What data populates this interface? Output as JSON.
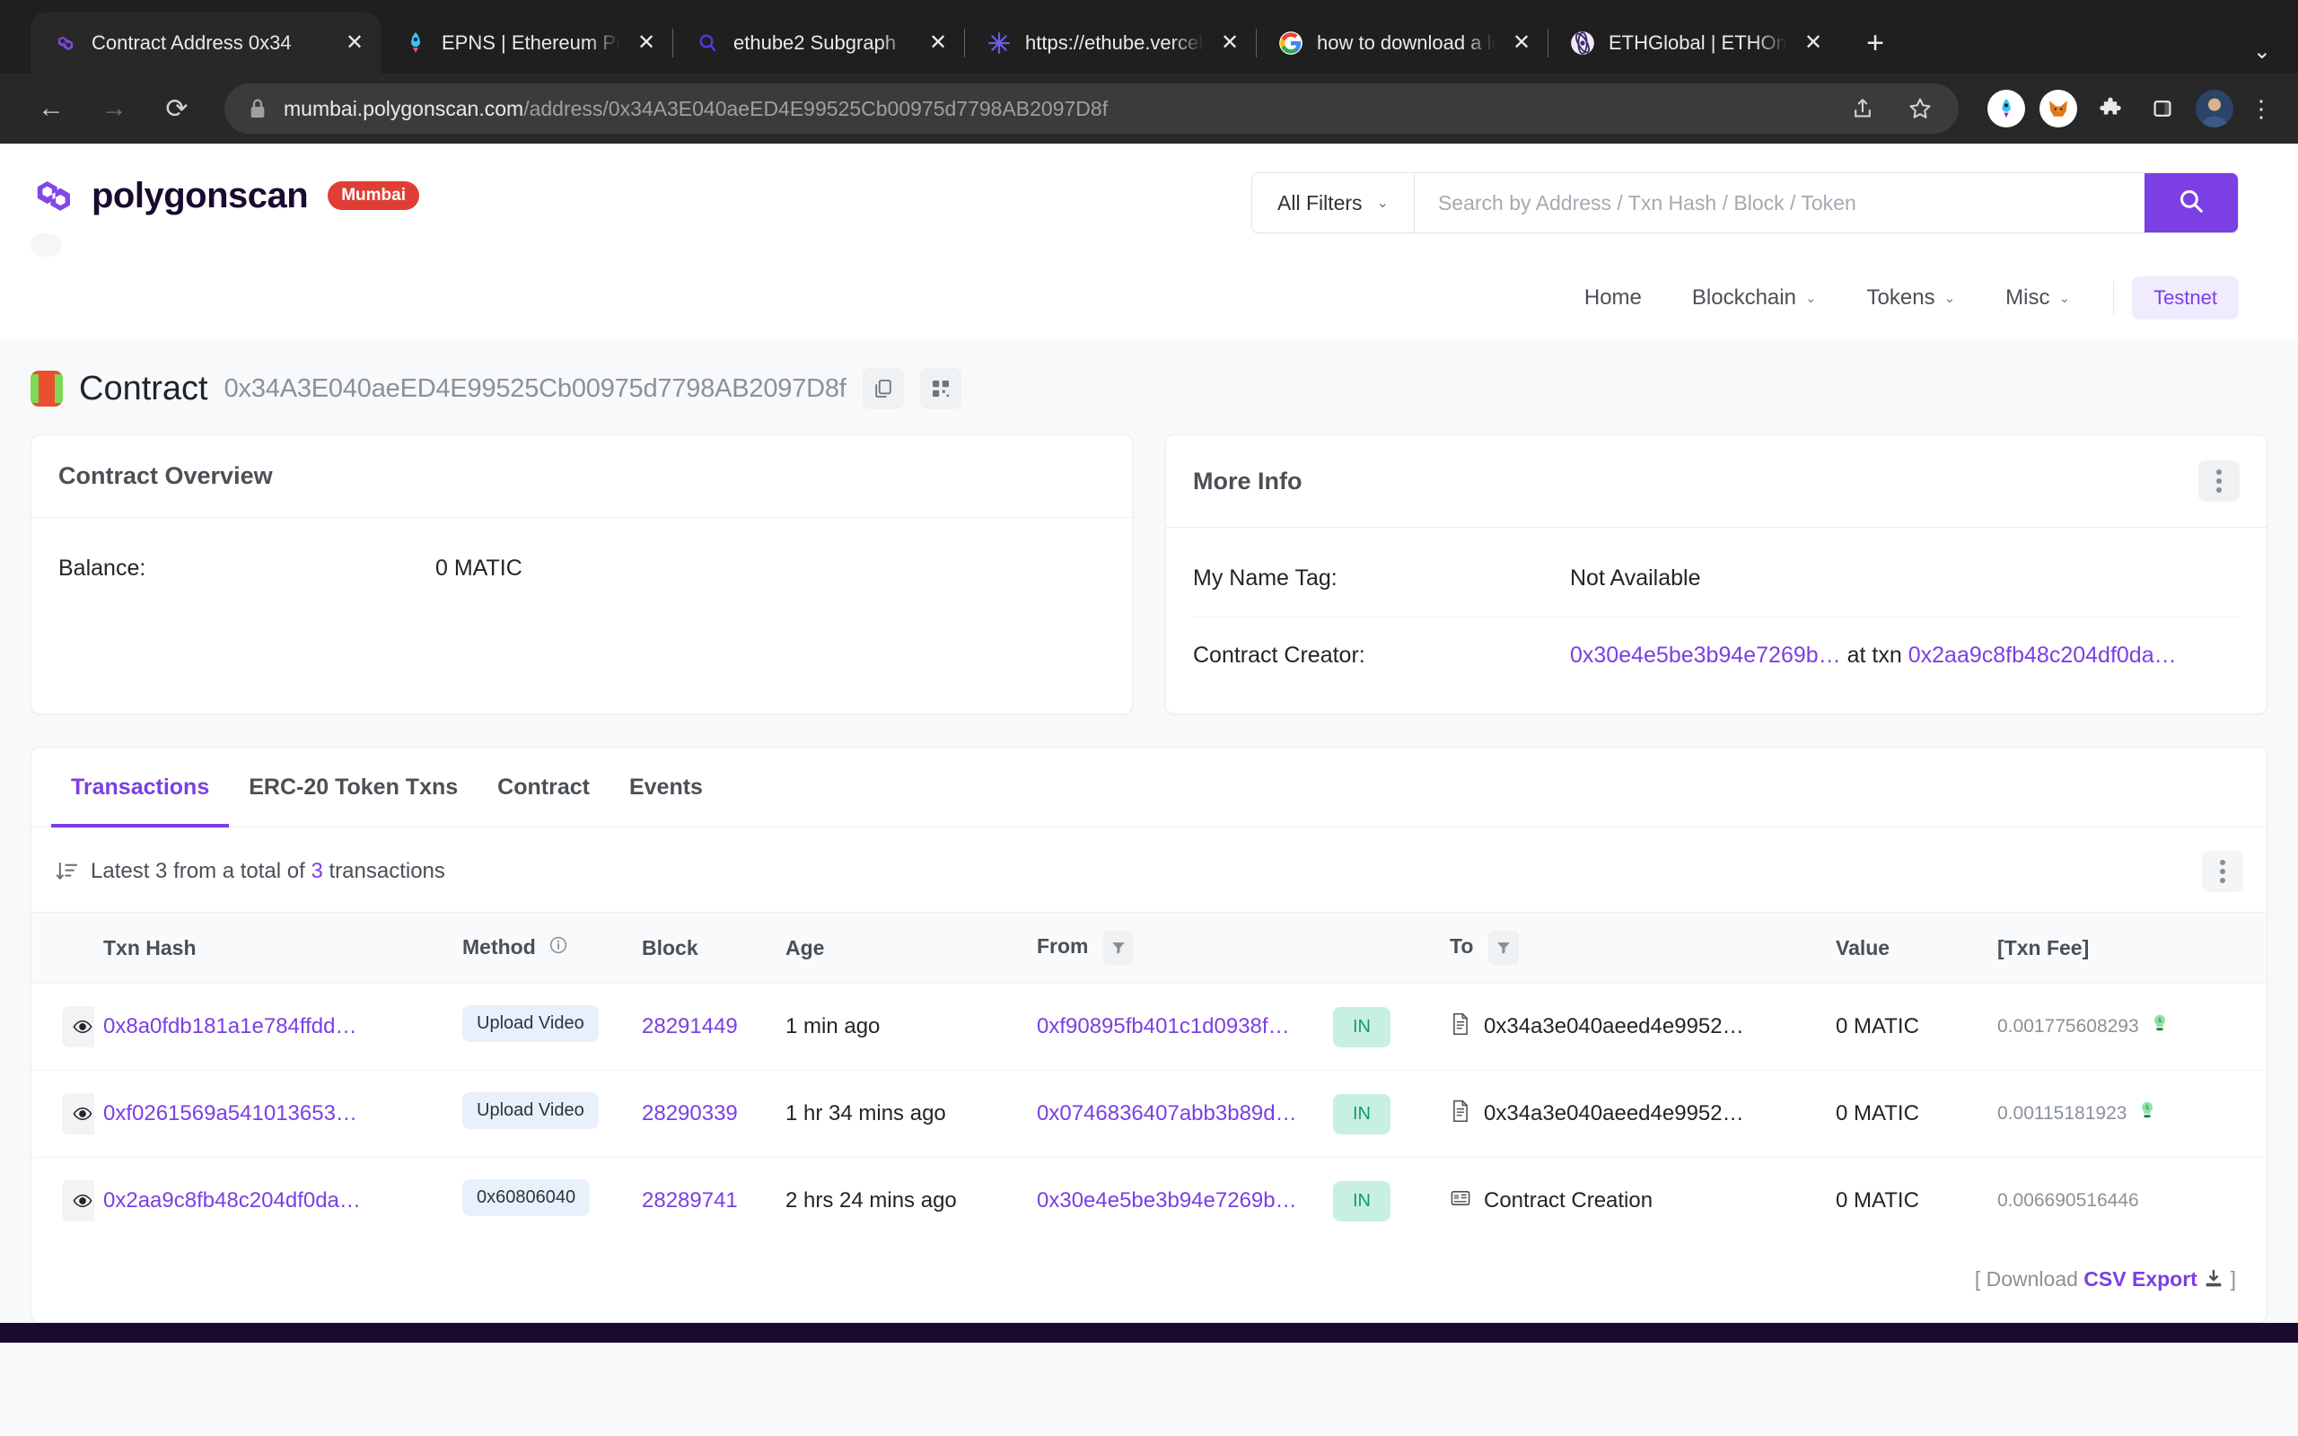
{
  "browser": {
    "tabs": [
      {
        "title": "Contract Address 0x34",
        "favicon": "polygon-icon",
        "active": true
      },
      {
        "title": "EPNS | Ethereum Push",
        "favicon": "rocket-icon",
        "active": false
      },
      {
        "title": "ethube2 Subgraph",
        "favicon": "graph-icon",
        "active": false
      },
      {
        "title": "https://ethube.vercel.a",
        "favicon": "snowflake-icon",
        "active": false
      },
      {
        "title": "how to download a loo",
        "favicon": "google-icon",
        "active": false
      },
      {
        "title": "ETHGlobal | ETHOnline",
        "favicon": "ethglobal-icon",
        "active": false
      }
    ],
    "new_tab_label": "+",
    "tab_list_chevron": "⌄",
    "close_label": "✕",
    "url_host": "mumbai.polygonscan.com",
    "url_path": "/address/0x34A3E040aeED4E99525Cb00975d7798AB2097D8f",
    "back_label": "←",
    "forward_label": "→",
    "reload_label": "⟳",
    "extensions": [
      "rocket-extension-icon",
      "metamask-icon",
      "puzzle-extension-icon",
      "sidepanel-icon",
      "profile-avatar"
    ],
    "menu_label": "⋮"
  },
  "site": {
    "brand_name": "polygonscan",
    "network_badge": "Mumbai",
    "search": {
      "filter_label": "All Filters",
      "filter_caret": "⌄",
      "placeholder": "Search by Address / Txn Hash / Block / Token",
      "value": ""
    },
    "nav": [
      {
        "label": "Home",
        "caret": ""
      },
      {
        "label": "Blockchain",
        "caret": "⌄"
      },
      {
        "label": "Tokens",
        "caret": "⌄"
      },
      {
        "label": "Misc",
        "caret": "⌄"
      }
    ],
    "testnet_label": "Testnet"
  },
  "page_title": {
    "label": "Contract",
    "address": "0x34A3E040aeED4E99525Cb00975d7798AB2097D8f",
    "copy_icon": "copy-icon",
    "qr_icon": "qr-code-icon"
  },
  "contract_overview": {
    "title": "Contract Overview",
    "rows": [
      {
        "key": "Balance:",
        "value": "0 MATIC"
      }
    ]
  },
  "more_info": {
    "title": "More Info",
    "menu_icon": "kebab-menu-icon",
    "rows": [
      {
        "key": "My Name Tag:",
        "value": "Not Available"
      }
    ],
    "creator_key": "Contract Creator:",
    "creator_address": "0x30e4e5be3b94e7269b…",
    "creator_at_txn": "at txn",
    "creator_txn": "0x2aa9c8fb48c204df0da…"
  },
  "tabs": [
    {
      "label": "Transactions",
      "active": true
    },
    {
      "label": "ERC-20 Token Txns",
      "active": false
    },
    {
      "label": "Contract",
      "active": false
    },
    {
      "label": "Events",
      "active": false
    }
  ],
  "table_toolbar": {
    "sort_icon": "sort-descending-icon",
    "prefix": "Latest 3 from a total of",
    "count": "3",
    "suffix": "transactions",
    "menu_icon": "kebab-menu-icon"
  },
  "table": {
    "columns": [
      {
        "key": "eye",
        "label": ""
      },
      {
        "key": "hash",
        "label": "Txn Hash"
      },
      {
        "key": "method",
        "label": "Method",
        "info": true
      },
      {
        "key": "block",
        "label": "Block"
      },
      {
        "key": "age",
        "label": "Age",
        "highlight": true
      },
      {
        "key": "from",
        "label": "From",
        "filter": true
      },
      {
        "key": "dir",
        "label": ""
      },
      {
        "key": "to",
        "label": "To",
        "filter": true
      },
      {
        "key": "value",
        "label": "Value"
      },
      {
        "key": "fee",
        "label": "[Txn Fee]"
      }
    ],
    "rows": [
      {
        "eye": "eye-icon",
        "hash": "0x8a0fdb181a1e784ffdd…",
        "method": "Upload Video",
        "block": "28291449",
        "age": "1 min ago",
        "from": "0xf90895fb401c1d0938f…",
        "dir": "IN",
        "to_icon": "contract-file-icon",
        "to": "0x34a3e040aeed4e9952…",
        "value": "0 MATIC",
        "fee": "0.001775608293",
        "fee_badge": "green-bulb-icon"
      },
      {
        "eye": "eye-icon",
        "hash": "0xf0261569a541013653…",
        "method": "Upload Video",
        "block": "28290339",
        "age": "1 hr 34 mins ago",
        "from": "0x0746836407abb3b89d…",
        "dir": "IN",
        "to_icon": "contract-file-icon",
        "to": "0x34a3e040aeed4e9952…",
        "value": "0 MATIC",
        "fee": "0.00115181923",
        "fee_badge": "green-bulb-icon"
      },
      {
        "eye": "eye-icon",
        "hash": "0x2aa9c8fb48c204df0da…",
        "method": "0x60806040",
        "block": "28289741",
        "age": "2 hrs 24 mins ago",
        "from": "0x30e4e5be3b94e7269b…",
        "dir": "IN",
        "to_icon": "contract-creation-icon",
        "to": "Contract Creation",
        "value": "0 MATIC",
        "fee": "0.006690516446",
        "fee_badge": ""
      }
    ]
  },
  "table_footer": {
    "open_bracket": "[",
    "download_label": "Download",
    "csv_label": "CSV Export",
    "download_icon": "download-icon",
    "close_bracket": "]"
  },
  "colors": {
    "accent": "#7b3fe4",
    "badge_red": "#e03e34",
    "in_pill_bg": "#c8f0e0",
    "in_pill_text": "#14967a",
    "method_pill_bg": "#e8f1fb"
  }
}
